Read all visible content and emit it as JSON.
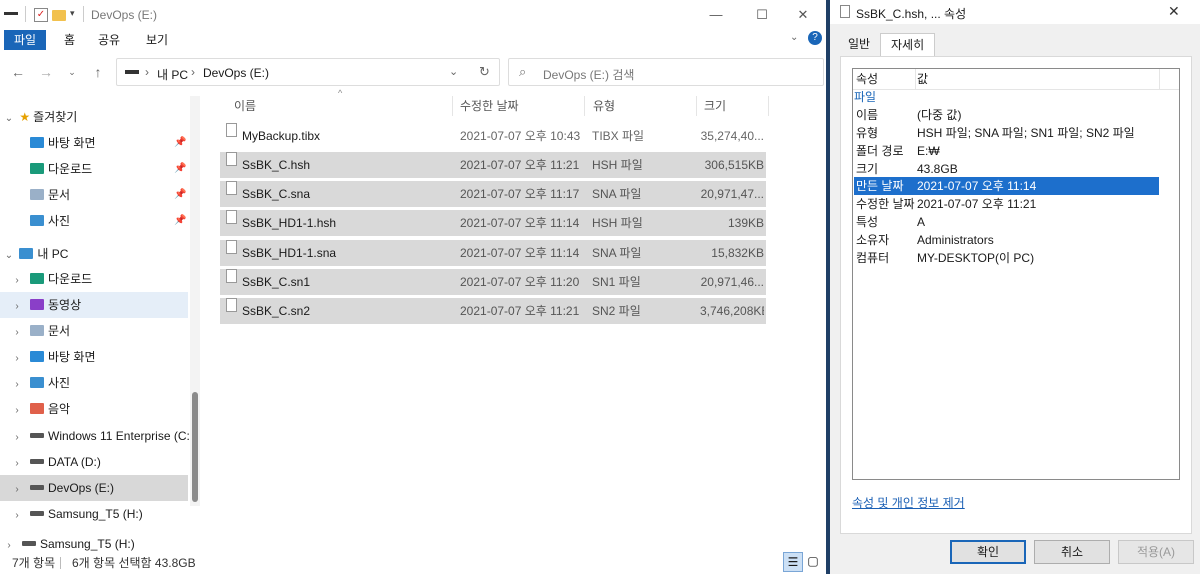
{
  "explorer": {
    "title": "DevOps (E:)",
    "ribbon_tabs": [
      "파일",
      "홈",
      "공유",
      "보기"
    ],
    "address_path": [
      "내 PC",
      "DevOps (E:)"
    ],
    "search_placeholder": "DevOps (E:) 검색",
    "nav": {
      "quick_access": "즐겨찾기",
      "quick_items": [
        "바탕 화면",
        "다운로드",
        "문서",
        "사진"
      ],
      "this_pc": "내 PC",
      "pc_items": [
        "다운로드",
        "동영상",
        "문서",
        "바탕 화면",
        "사진",
        "음악",
        "Windows 11 Enterprise (C:)",
        "DATA (D:)",
        "DevOps (E:)",
        "Samsung_T5 (H:)",
        "Samsung_T5 (H:)"
      ]
    },
    "columns": [
      "이름",
      "수정한 날짜",
      "유형",
      "크기"
    ],
    "files": [
      {
        "name": "MyBackup.tibx",
        "date": "2021-07-07 오후 10:43",
        "type": "TIBX 파일",
        "size": "35,274,40..."
      },
      {
        "name": "SsBK_C.hsh",
        "date": "2021-07-07 오후 11:21",
        "type": "HSH 파일",
        "size": "306,515KB"
      },
      {
        "name": "SsBK_C.sna",
        "date": "2021-07-07 오후 11:17",
        "type": "SNA 파일",
        "size": "20,971,47..."
      },
      {
        "name": "SsBK_HD1-1.hsh",
        "date": "2021-07-07 오후 11:14",
        "type": "HSH 파일",
        "size": "139KB"
      },
      {
        "name": "SsBK_HD1-1.sna",
        "date": "2021-07-07 오후 11:14",
        "type": "SNA 파일",
        "size": "15,832KB"
      },
      {
        "name": "SsBK_C.sn1",
        "date": "2021-07-07 오후 11:20",
        "type": "SN1 파일",
        "size": "20,971,46..."
      },
      {
        "name": "SsBK_C.sn2",
        "date": "2021-07-07 오후 11:21",
        "type": "SN2 파일",
        "size": "3,746,208KB"
      }
    ],
    "status": {
      "count": "7개 항목",
      "selected": "6개 항목 선택함 43.8GB"
    }
  },
  "props": {
    "title": "SsBK_C.hsh, ... 속성",
    "tabs": [
      "일반",
      "자세히"
    ],
    "header": {
      "key": "속성",
      "value": "값"
    },
    "group": "파일",
    "rows": [
      {
        "k": "이름",
        "v": "(다중 값)"
      },
      {
        "k": "유형",
        "v": "HSH 파일; SNA 파일; SN1 파일; SN2 파일"
      },
      {
        "k": "폴더 경로",
        "v": "E:₩"
      },
      {
        "k": "크기",
        "v": "43.8GB"
      },
      {
        "k": "만든 날짜",
        "v": "2021-07-07 오후 11:14"
      },
      {
        "k": "수정한 날짜",
        "v": "2021-07-07 오후 11:21"
      },
      {
        "k": "특성",
        "v": "A"
      },
      {
        "k": "소유자",
        "v": "Administrators"
      },
      {
        "k": "컴퓨터",
        "v": "MY-DESKTOP(이 PC)"
      }
    ],
    "remove_link": "속성 및 개인 정보 제거",
    "buttons": {
      "ok": "확인",
      "cancel": "취소",
      "apply": "적용(A)"
    }
  }
}
